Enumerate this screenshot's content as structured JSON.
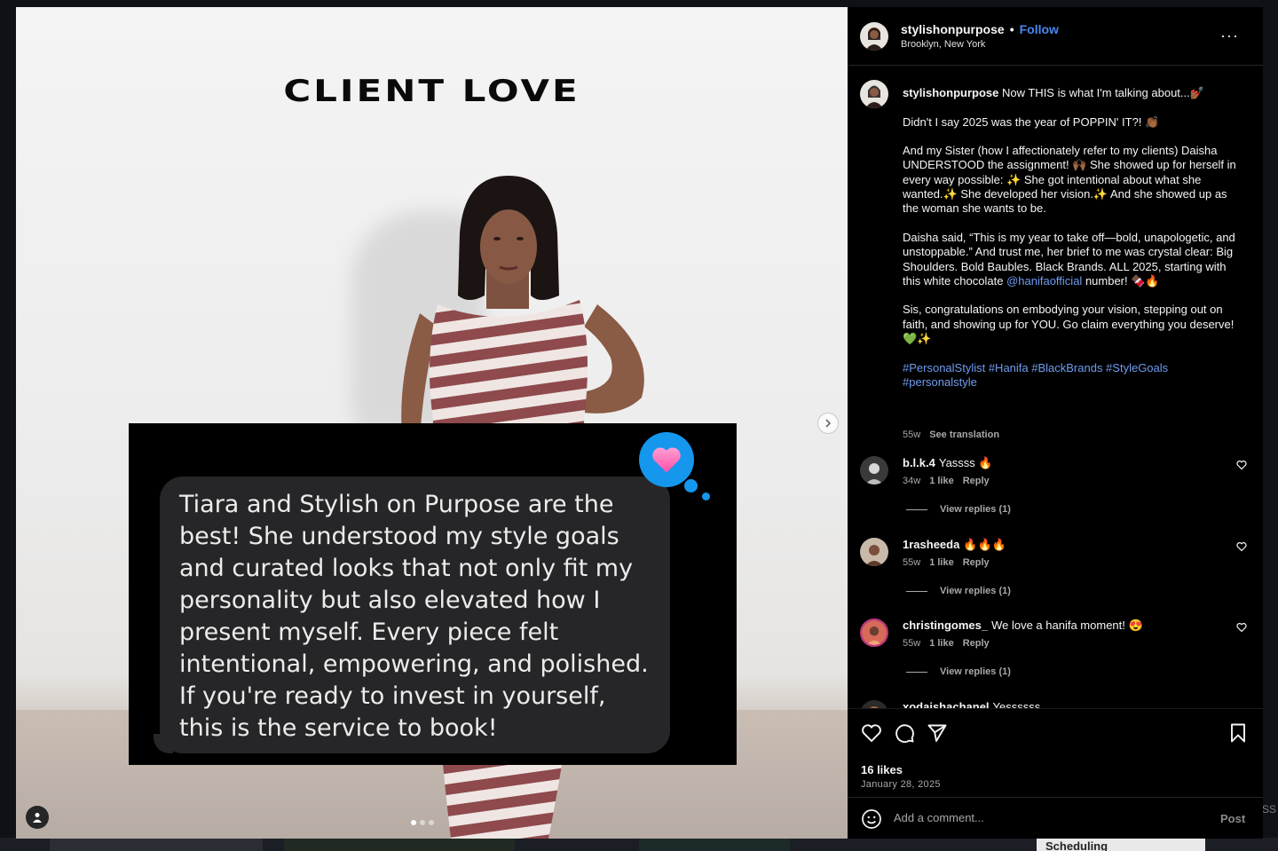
{
  "post": {
    "username": "stylishonpurpose",
    "separator": "•",
    "follow_label": "Follow",
    "location": "Brooklyn, New York",
    "more_label": "···",
    "image": {
      "title": "CLIENT LOVE",
      "testimonial": "Tiara and Stylish on Purpose are the best! She understood my style goals and curated looks that not only fit my personality but also elevated how I present myself. Every piece felt intentional, empowering, and polished. If you're ready to invest in yourself, this is the service to book!",
      "heart_emoji": "💗"
    },
    "caption": {
      "username": "stylishonpurpose",
      "p1": "Now THIS is what I'm talking about...💅🏾",
      "p2": "Didn't I say 2025 was the year of POPPIN' IT?! 👏🏾",
      "p3": "And my Sister (how I affectionately refer to my clients) Daisha UNDERSTOOD the assignment! 🙌🏾 She showed up for herself in every way possible: ✨ She got intentional about what she wanted.✨ She developed her vision.✨ And she showed up as the woman she wants to be.",
      "p4_a": "Daisha said, “This is my year to take off—bold, unapologetic, and unstoppable.” And trust me, her brief to me was crystal clear: Big Shoulders. Bold Baubles. Black Brands. ALL 2025, starting with this white chocolate",
      "p4_mention": "@hanifaofficial",
      "p4_b": "number! 🍫🔥",
      "p5": "Sis, congratulations on embodying your vision, stepping out on faith, and showing up for YOU. Go claim everything you deserve! 💚✨",
      "tags": "#PersonalStylist #Hanifa #BlackBrands #StyleGoals #personalstyle",
      "age": "55w",
      "see_translation": "See translation"
    },
    "comments": [
      {
        "username": "b.l.k.4",
        "text": "Yassss 🔥",
        "age": "34w",
        "likes": "1 like",
        "reply": "Reply",
        "view_replies": "View replies (1)"
      },
      {
        "username": "1rasheeda",
        "text": "🔥🔥🔥",
        "age": "55w",
        "likes": "1 like",
        "reply": "Reply",
        "view_replies": "View replies (1)"
      },
      {
        "username": "christingomes_",
        "text": "We love a hanifa moment! 😍",
        "age": "55w",
        "likes": "1 like",
        "reply": "Reply",
        "view_replies": "View replies (1)"
      },
      {
        "username": "xodaishachanel",
        "text": "Yessssss"
      }
    ],
    "likes": "16 likes",
    "date": "January 28, 2025",
    "add_comment_placeholder": "Add a comment...",
    "post_button": "Post"
  },
  "background": {
    "scheduling_label": "Scheduling",
    "edge_text": "SS"
  },
  "colors": {
    "accent_blue": "#4a86f0",
    "link_blue": "#6f9cf1",
    "panel_bg": "#000000",
    "heart_badge": "#1597ee"
  }
}
